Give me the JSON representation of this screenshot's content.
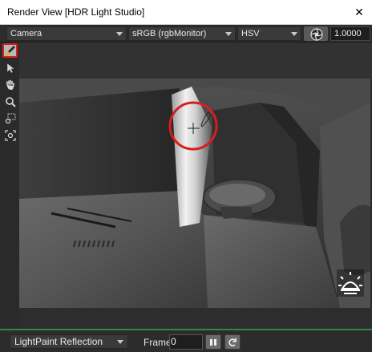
{
  "window": {
    "title": "Render View [HDR Light Studio]",
    "close_label": "✕"
  },
  "toolbar": {
    "camera": "Camera",
    "color_space": "sRGB (rgbMonitor)",
    "color_mode": "HSV",
    "exposure_value": "1.0000"
  },
  "tools": [
    {
      "name": "lightpaint-brush-tool",
      "active": true
    },
    {
      "name": "select-arrow-tool",
      "active": false
    },
    {
      "name": "pan-hand-tool",
      "active": false
    },
    {
      "name": "zoom-magnifier-tool",
      "active": false
    },
    {
      "name": "zoom-region-tool",
      "active": false
    },
    {
      "name": "fit-view-tool",
      "active": false
    }
  ],
  "bottom": {
    "mode": "LightPaint Reflection",
    "frame_label": "Frame",
    "frame_value": "0"
  },
  "colors": {
    "highlight_red": "#d81e1e",
    "status_green": "#2f8b3a"
  }
}
